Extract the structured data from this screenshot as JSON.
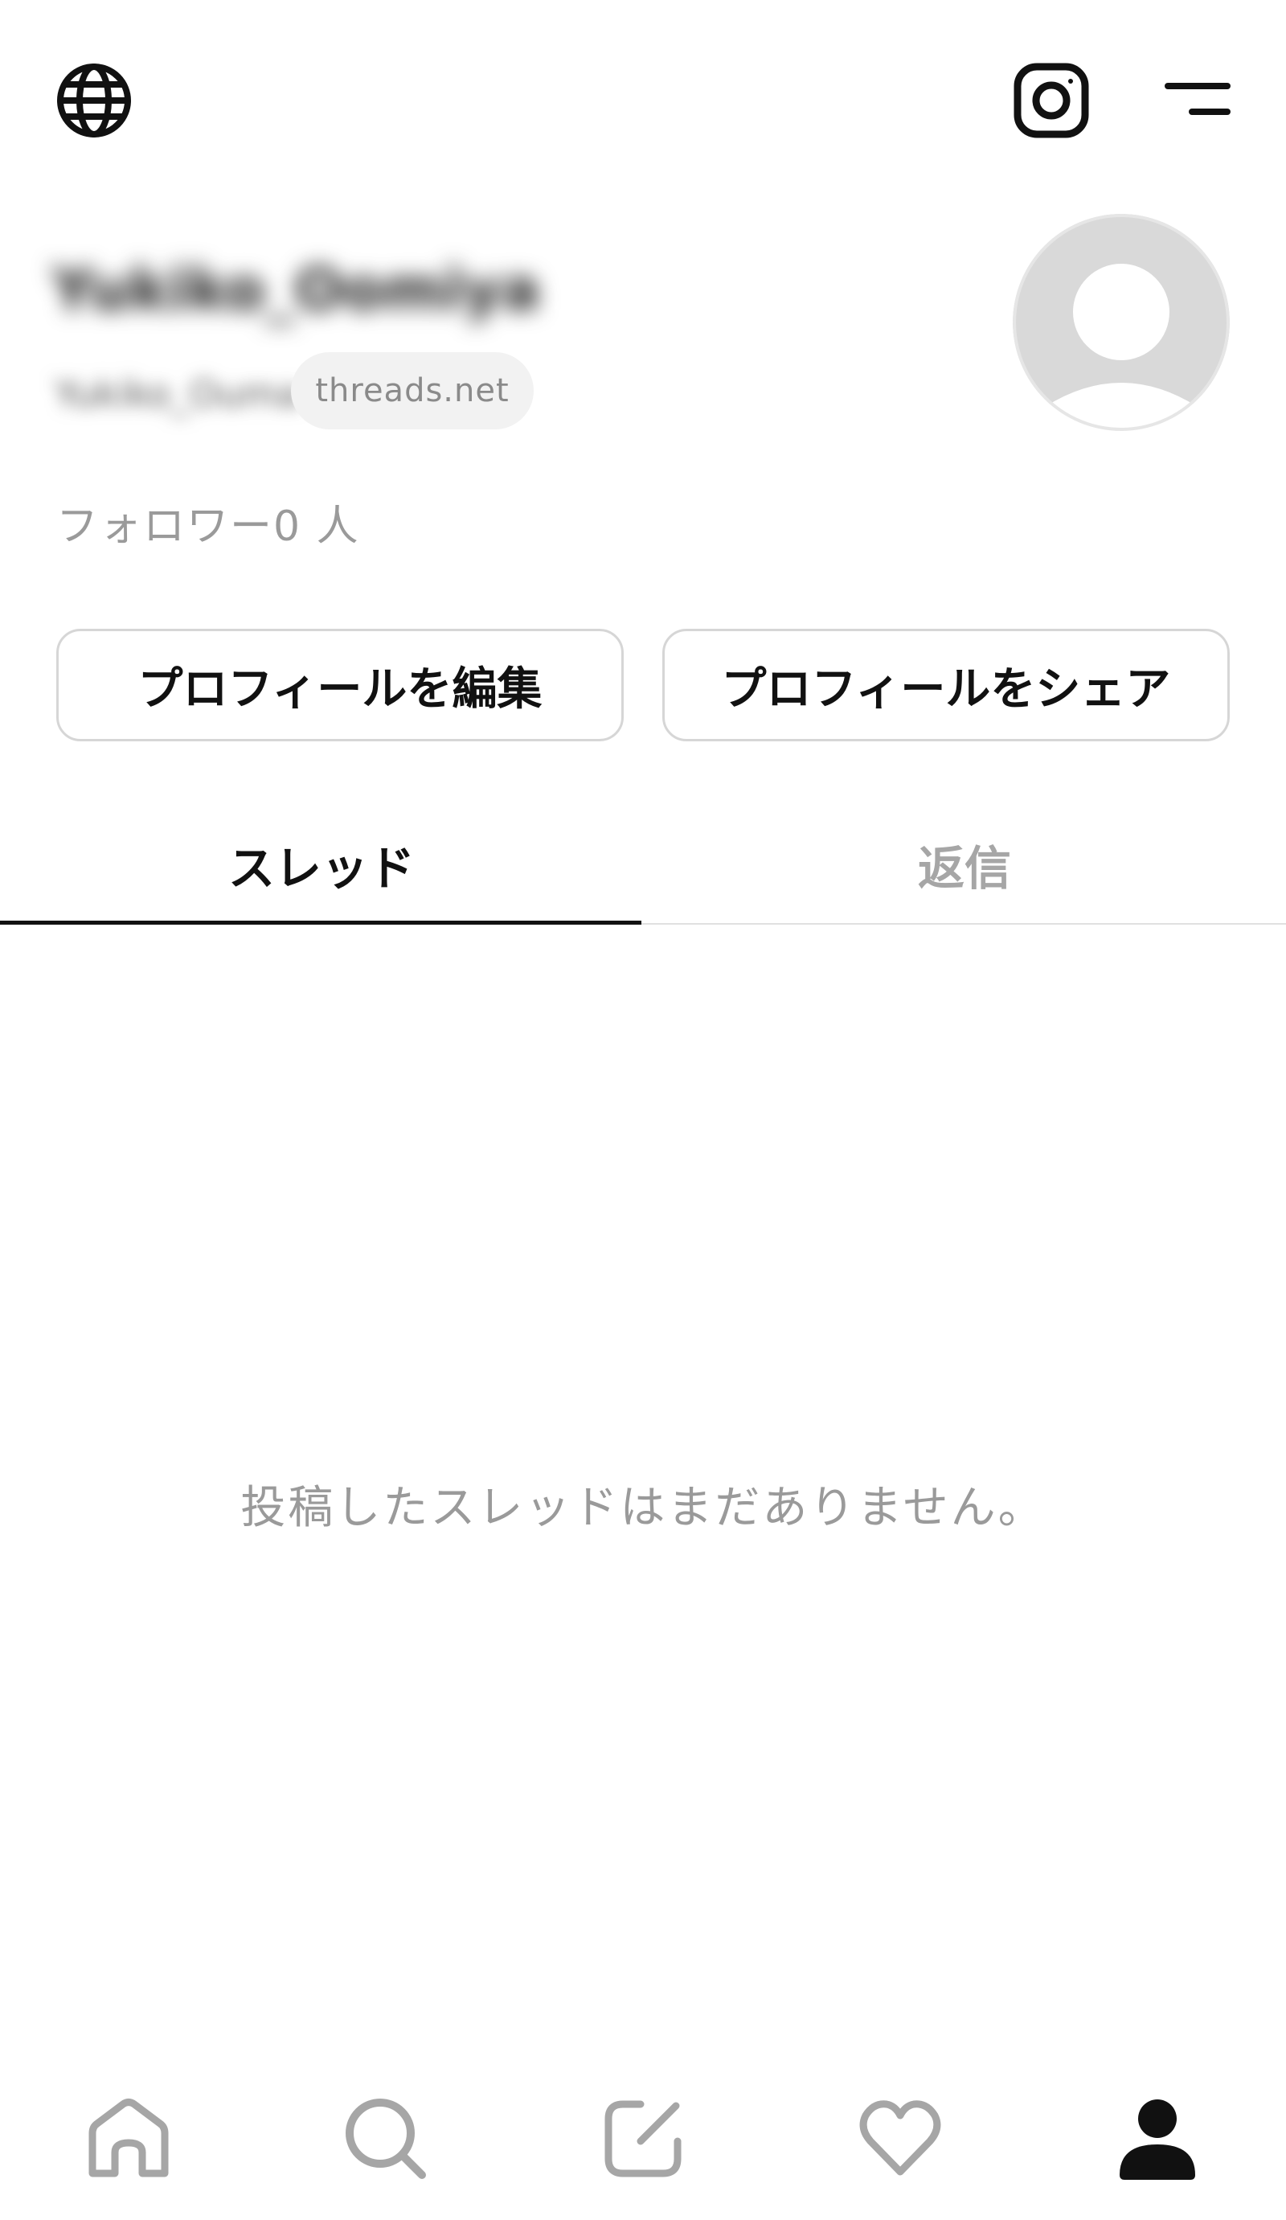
{
  "header": {
    "left_icon": "globe-icon",
    "right_icons": [
      "instagram-icon",
      "menu-icon"
    ]
  },
  "profile": {
    "display_name": "Yukiko_Oomiya",
    "handle": "Yukiko_Ouma",
    "domain_badge": "threads.net",
    "avatar_icon": "default-avatar-icon",
    "followers_text": "フォロワー0 人"
  },
  "actions": {
    "edit_label": "プロフィールを編集",
    "share_label": "プロフィールをシェア"
  },
  "tabs": [
    {
      "label": "スレッド",
      "active": true
    },
    {
      "label": "返信",
      "active": false
    }
  ],
  "empty_state": {
    "message": "投稿したスレッドはまだありません。"
  },
  "bottom_nav": {
    "items": [
      {
        "icon": "home-icon",
        "active": false
      },
      {
        "icon": "search-icon",
        "active": false
      },
      {
        "icon": "compose-icon",
        "active": false
      },
      {
        "icon": "heart-icon",
        "active": false
      },
      {
        "icon": "profile-icon",
        "active": true
      }
    ]
  },
  "colors": {
    "active": "#111111",
    "inactive": "#a6a6a6",
    "muted_text": "#9a9a9a",
    "pill_bg": "#f2f2f2",
    "button_border": "#d6d6d6"
  }
}
